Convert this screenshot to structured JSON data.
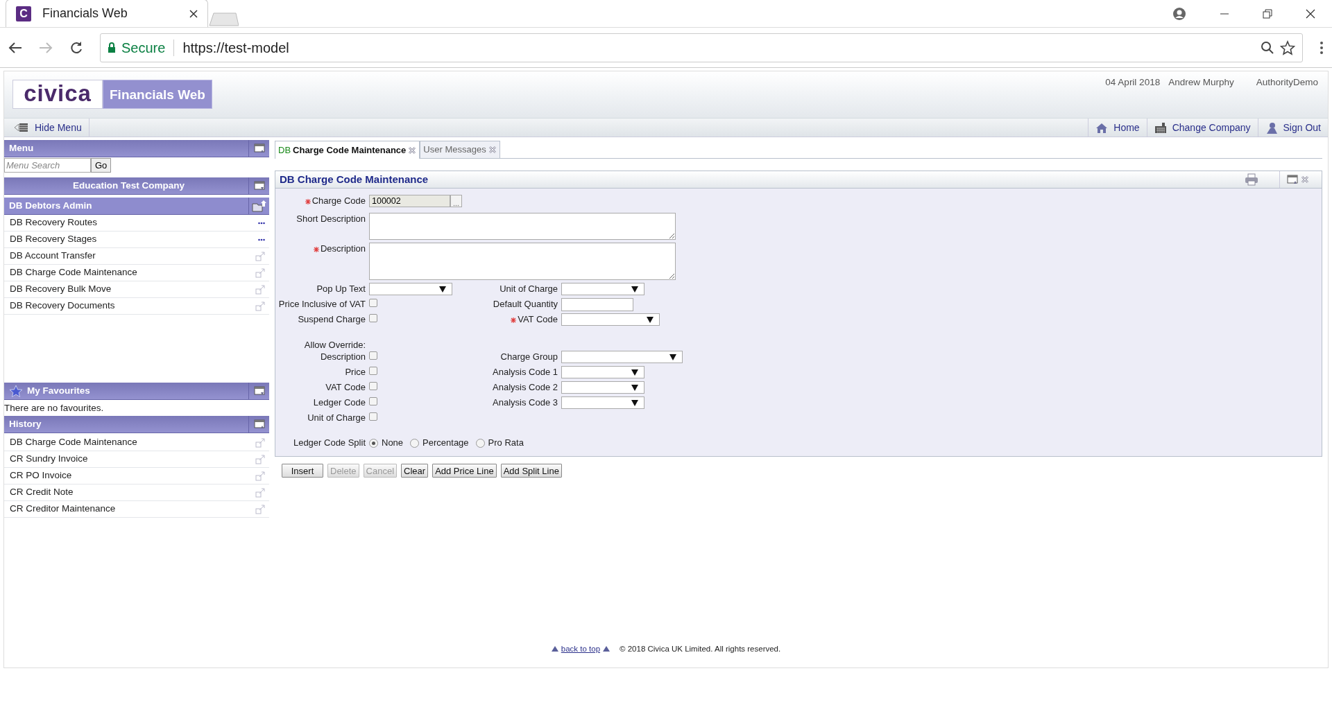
{
  "browser": {
    "tab_icon": "C",
    "tab_title": "Financials Web",
    "secure_label": "Secure",
    "url": "https://test-model"
  },
  "header": {
    "logo": "civica",
    "product": "Financials Web",
    "date": "04 April 2018",
    "user": "Andrew Murphy",
    "authority": "AuthorityDemo"
  },
  "nav": {
    "hide_menu": "Hide Menu",
    "links": [
      {
        "label": "Home",
        "kind": "home"
      },
      {
        "label": "Change Company",
        "kind": "company"
      },
      {
        "label": "Sign Out",
        "kind": "signout"
      }
    ]
  },
  "sidebar": {
    "menu_title": "Menu",
    "search": {
      "placeholder": "Menu Search",
      "button": "Go"
    },
    "company": "Education Test Company",
    "group": "DB Debtors Admin",
    "items": [
      {
        "label": "DB Recovery Routes",
        "kind": "more"
      },
      {
        "label": "DB Recovery Stages",
        "kind": "more"
      },
      {
        "label": "DB Account Transfer",
        "kind": "open"
      },
      {
        "label": "DB Charge Code Maintenance",
        "kind": "open"
      },
      {
        "label": "DB Recovery Bulk Move",
        "kind": "open"
      },
      {
        "label": "DB Recovery Documents",
        "kind": "open"
      }
    ],
    "favourites_title": "My Favourites",
    "favourites_empty": "There are no favourites.",
    "history_title": "History",
    "history": [
      {
        "label": "DB Charge Code Maintenance"
      },
      {
        "label": "CR Sundry Invoice"
      },
      {
        "label": "CR PO Invoice"
      },
      {
        "label": "CR Credit Note"
      },
      {
        "label": "CR Creditor Maintenance"
      }
    ]
  },
  "tabs": [
    {
      "prefix": "DB",
      "label": "Charge Code Maintenance",
      "selected": true
    },
    {
      "label": "User Messages",
      "selected": false
    }
  ],
  "panel": {
    "title": "DB Charge Code Maintenance"
  },
  "form": {
    "charge_code": {
      "label": "Charge Code",
      "required": true,
      "value": "100002"
    },
    "text_areas": [
      {
        "label": "Short Description",
        "required": false
      },
      {
        "label": "Description",
        "required": true
      }
    ],
    "rows": [
      {
        "left": {
          "kind": "select",
          "label": "Pop Up Text"
        },
        "right": {
          "kind": "select",
          "label": "Unit of Charge"
        }
      },
      {
        "left": {
          "kind": "checkbox",
          "label": "Price Inclusive of VAT",
          "checked": false
        },
        "right": {
          "kind": "text",
          "label": "Default Quantity"
        }
      },
      {
        "left": {
          "kind": "checkbox",
          "label": "Suspend Charge",
          "checked": false
        },
        "right": {
          "kind": "select",
          "label": "VAT Code",
          "required": true
        }
      },
      {
        "left": {
          "kind": "heading",
          "label": "Allow Override:"
        }
      },
      {
        "left": {
          "kind": "checkbox",
          "label": "Description",
          "checked": false
        },
        "right": {
          "kind": "select",
          "label": "Charge Group"
        }
      },
      {
        "left": {
          "kind": "checkbox",
          "label": "Price",
          "checked": false
        },
        "right": {
          "kind": "select",
          "label": "Analysis Code 1"
        }
      },
      {
        "left": {
          "kind": "checkbox",
          "label": "VAT Code",
          "checked": false
        },
        "right": {
          "kind": "select",
          "label": "Analysis Code 2"
        }
      },
      {
        "left": {
          "kind": "checkbox",
          "label": "Ledger Code",
          "checked": false
        },
        "right": {
          "kind": "select",
          "label": "Analysis Code 3"
        }
      },
      {
        "left": {
          "kind": "checkbox",
          "label": "Unit of Charge",
          "checked": false
        }
      }
    ],
    "split": {
      "label": "Ledger Code Split",
      "options": [
        {
          "label": "None",
          "selected": true
        },
        {
          "label": "Percentage",
          "selected": false
        },
        {
          "label": "Pro Rata",
          "selected": false
        }
      ]
    }
  },
  "buttons": [
    {
      "label": "Insert",
      "disabled": false
    },
    {
      "label": "Delete",
      "disabled": true
    },
    {
      "label": "Cancel",
      "disabled": true
    },
    {
      "label": "Clear",
      "disabled": false
    },
    {
      "label": "Add Price Line",
      "disabled": false
    },
    {
      "label": "Add Split Line",
      "disabled": false
    }
  ],
  "footer": {
    "back_to_top": "back to top",
    "copyright": "© 2018 Civica UK Limited. All rights reserved."
  }
}
